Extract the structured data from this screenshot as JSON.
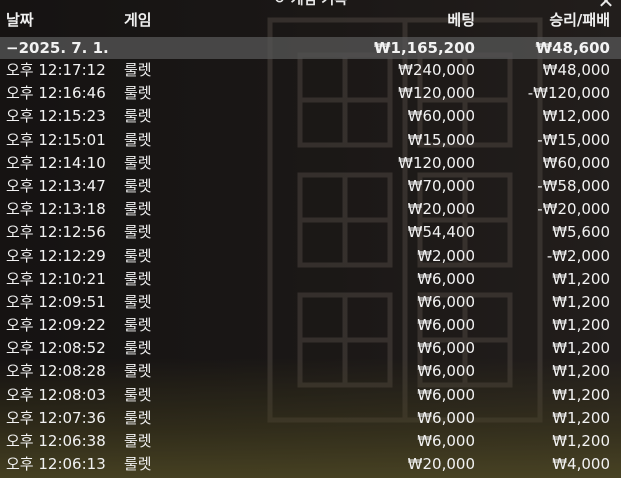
{
  "window": {
    "title": "게임 기록",
    "title_icon": "clock-history-icon",
    "close_label": "✕"
  },
  "columns": {
    "date": "날짜",
    "game": "게임",
    "bet": "베팅",
    "win_loss": "승리/패배"
  },
  "summary": {
    "date": "−2025. 7. 1.",
    "bet": "₩1,165,200",
    "win_loss": "₩48,600"
  },
  "rows": [
    {
      "time": "오후 12:17:12",
      "game": "룰렛",
      "bet": "₩240,000",
      "win_loss": "₩48,000"
    },
    {
      "time": "오후 12:16:46",
      "game": "룰렛",
      "bet": "₩120,000",
      "win_loss": "-₩120,000"
    },
    {
      "time": "오후 12:15:23",
      "game": "룰렛",
      "bet": "₩60,000",
      "win_loss": "₩12,000"
    },
    {
      "time": "오후 12:15:01",
      "game": "룰렛",
      "bet": "₩15,000",
      "win_loss": "-₩15,000"
    },
    {
      "time": "오후 12:14:10",
      "game": "룰렛",
      "bet": "₩120,000",
      "win_loss": "₩60,000"
    },
    {
      "time": "오후 12:13:47",
      "game": "룰렛",
      "bet": "₩70,000",
      "win_loss": "-₩58,000"
    },
    {
      "time": "오후 12:13:18",
      "game": "룰렛",
      "bet": "₩20,000",
      "win_loss": "-₩20,000"
    },
    {
      "time": "오후 12:12:56",
      "game": "룰렛",
      "bet": "₩54,400",
      "win_loss": "₩5,600"
    },
    {
      "time": "오후 12:12:29",
      "game": "룰렛",
      "bet": "₩2,000",
      "win_loss": "-₩2,000"
    },
    {
      "time": "오후 12:10:21",
      "game": "룰렛",
      "bet": "₩6,000",
      "win_loss": "₩1,200"
    },
    {
      "time": "오후 12:09:51",
      "game": "룰렛",
      "bet": "₩6,000",
      "win_loss": "₩1,200"
    },
    {
      "time": "오후 12:09:22",
      "game": "룰렛",
      "bet": "₩6,000",
      "win_loss": "₩1,200"
    },
    {
      "time": "오후 12:08:52",
      "game": "룰렛",
      "bet": "₩6,000",
      "win_loss": "₩1,200"
    },
    {
      "time": "오후 12:08:28",
      "game": "룰렛",
      "bet": "₩6,000",
      "win_loss": "₩1,200"
    },
    {
      "time": "오후 12:08:03",
      "game": "룰렛",
      "bet": "₩6,000",
      "win_loss": "₩1,200"
    },
    {
      "time": "오후 12:07:36",
      "game": "룰렛",
      "bet": "₩6,000",
      "win_loss": "₩1,200"
    },
    {
      "time": "오후 12:06:38",
      "game": "룰렛",
      "bet": "₩6,000",
      "win_loss": "₩1,200"
    },
    {
      "time": "오후 12:06:13",
      "game": "룰렛",
      "bet": "₩20,000",
      "win_loss": "₩4,000"
    }
  ]
}
